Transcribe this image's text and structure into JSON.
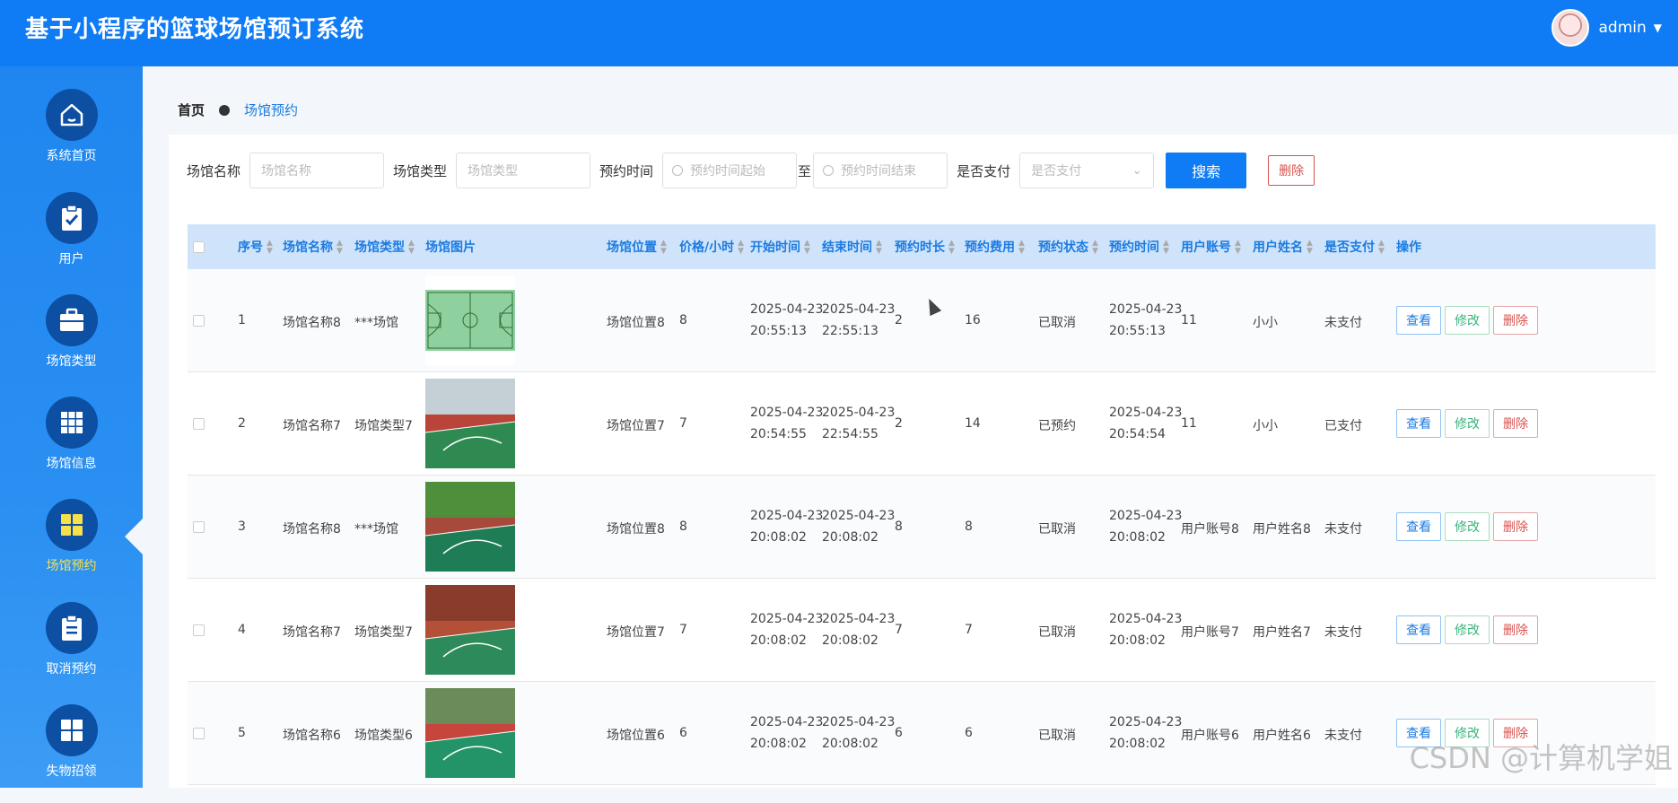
{
  "header": {
    "title": "基于小程序的篮球场馆预订系统",
    "username": "admin"
  },
  "sidebar": {
    "items": [
      {
        "label": "系统首页",
        "icon": "home-icon"
      },
      {
        "label": "用户",
        "icon": "clipboard-check-icon"
      },
      {
        "label": "场馆类型",
        "icon": "briefcase-icon"
      },
      {
        "label": "场馆信息",
        "icon": "grid-icon"
      },
      {
        "label": "场馆预约",
        "icon": "apps-icon",
        "active": true
      },
      {
        "label": "取消预约",
        "icon": "clipboard-list-icon"
      },
      {
        "label": "失物招领",
        "icon": "apps-icon"
      }
    ]
  },
  "breadcrumb": {
    "home": "首页",
    "current": "场馆预约"
  },
  "filters": {
    "name_label": "场馆名称",
    "name_placeholder": "场馆名称",
    "type_label": "场馆类型",
    "type_placeholder": "场馆类型",
    "time_label": "预约时间",
    "time_start_placeholder": "预约时间起始",
    "to": "至",
    "time_end_placeholder": "预约时间结束",
    "paid_label": "是否支付",
    "paid_placeholder": "是否支付",
    "search_button": "搜索",
    "delete_button": "删除"
  },
  "table": {
    "headers": [
      "序号",
      "场馆名称",
      "场馆类型",
      "场馆图片",
      "场馆位置",
      "价格/小时",
      "开始时间",
      "结束时间",
      "预约时长",
      "预约费用",
      "预约状态",
      "预约时间",
      "用户账号",
      "用户姓名",
      "是否支付",
      "操作"
    ],
    "actions": {
      "view": "查看",
      "edit": "修改",
      "delete": "删除"
    },
    "rows": [
      {
        "no": "1",
        "name": "场馆名称8",
        "type": "***场馆",
        "image": "court-diagram",
        "location": "场馆位置8",
        "price": "8",
        "start_date": "2025-04-23",
        "start_time": "20:55:13",
        "end_date": "2025-04-23",
        "end_time": "22:55:13",
        "duration": "2",
        "fee": "16",
        "status": "已取消",
        "book_date": "2025-04-23",
        "book_time": "20:55:13",
        "account": "11",
        "user": "小小",
        "paid": "未支付"
      },
      {
        "no": "2",
        "name": "场馆名称7",
        "type": "场馆类型7",
        "image": "court-photo-a",
        "location": "场馆位置7",
        "price": "7",
        "start_date": "2025-04-23",
        "start_time": "20:54:55",
        "end_date": "2025-04-23",
        "end_time": "22:54:55",
        "duration": "2",
        "fee": "14",
        "status": "已预约",
        "book_date": "2025-04-23",
        "book_time": "20:54:54",
        "account": "11",
        "user": "小小",
        "paid": "已支付"
      },
      {
        "no": "3",
        "name": "场馆名称8",
        "type": "***场馆",
        "image": "court-photo-b",
        "location": "场馆位置8",
        "price": "8",
        "start_date": "2025-04-23",
        "start_time": "20:08:02",
        "end_date": "2025-04-23",
        "end_time": "20:08:02",
        "duration": "8",
        "fee": "8",
        "status": "已取消",
        "book_date": "2025-04-23",
        "book_time": "20:08:02",
        "account": "用户账号8",
        "user": "用户姓名8",
        "paid": "未支付"
      },
      {
        "no": "4",
        "name": "场馆名称7",
        "type": "场馆类型7",
        "image": "court-photo-c",
        "location": "场馆位置7",
        "price": "7",
        "start_date": "2025-04-23",
        "start_time": "20:08:02",
        "end_date": "2025-04-23",
        "end_time": "20:08:02",
        "duration": "7",
        "fee": "7",
        "status": "已取消",
        "book_date": "2025-04-23",
        "book_time": "20:08:02",
        "account": "用户账号7",
        "user": "用户姓名7",
        "paid": "未支付"
      },
      {
        "no": "5",
        "name": "场馆名称6",
        "type": "场馆类型6",
        "image": "court-photo-d",
        "location": "场馆位置6",
        "price": "6",
        "start_date": "2025-04-23",
        "start_time": "20:08:02",
        "end_date": "2025-04-23",
        "end_time": "20:08:02",
        "duration": "6",
        "fee": "6",
        "status": "已取消",
        "book_date": "2025-04-23",
        "book_time": "20:08:02",
        "account": "用户账号6",
        "user": "用户姓名6",
        "paid": "未支付"
      }
    ]
  },
  "watermark": "CSDN @计算机学姐",
  "colors": {
    "primary": "#0f7cf5",
    "sidebar_active": "#f7e14a",
    "danger": "#d9534f",
    "success": "#39b37a"
  }
}
